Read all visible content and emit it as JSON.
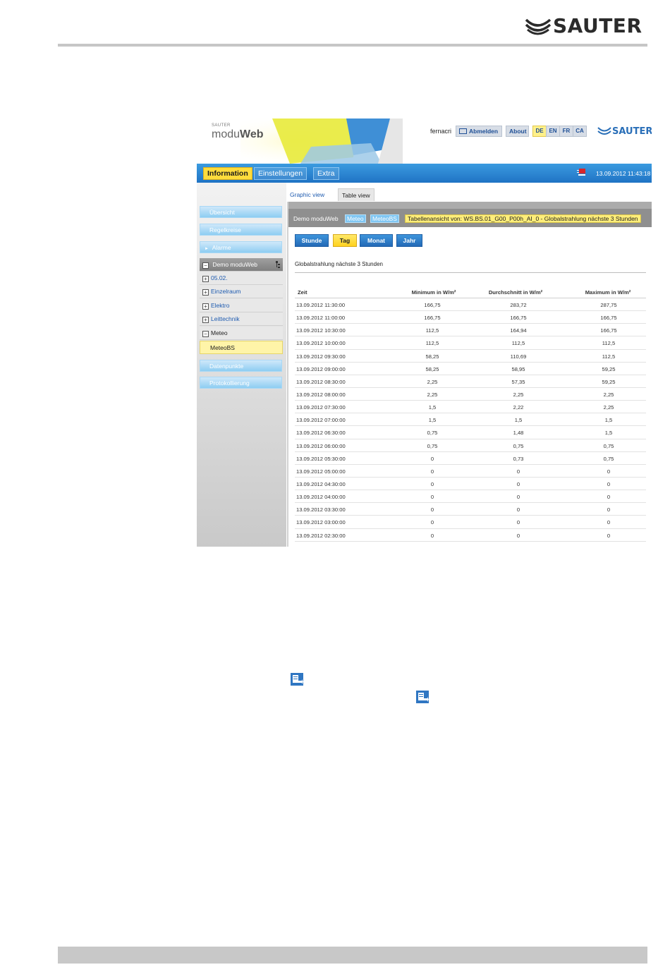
{
  "page": {
    "brand": "SAUTER"
  },
  "app": {
    "brand_small": "SAUTER",
    "brand_main_light": "modu",
    "brand_main_bold": "Web",
    "user": "fernacri",
    "logout_label": "Abmelden",
    "about_label": "About",
    "languages": [
      {
        "code": "DE",
        "active": true
      },
      {
        "code": "EN",
        "active": false
      },
      {
        "code": "FR",
        "active": false
      },
      {
        "code": "CA",
        "active": false
      }
    ],
    "logo_brand": "SAUTER",
    "nav": [
      {
        "label": "Information",
        "active": true
      },
      {
        "label": "Einstellungen",
        "active": false
      },
      {
        "label": "Extra",
        "active": false
      }
    ],
    "datetime": "13.09.2012 11:43:18"
  },
  "sidebar": {
    "items": [
      {
        "label": "Übersicht"
      },
      {
        "label": "Regelkreise"
      },
      {
        "label": "Alarme"
      }
    ],
    "tree_root": "Demo moduWeb",
    "tree_children": [
      {
        "label": "05.02.",
        "expander": "+"
      },
      {
        "label": "Einzelraum",
        "expander": "+"
      },
      {
        "label": "Elektro",
        "expander": "+"
      },
      {
        "label": "Leittechnik",
        "expander": "+"
      },
      {
        "label": "Meteo",
        "expander": "−"
      }
    ],
    "tree_selected": "MeteoBS",
    "bottom_items": [
      {
        "label": "Datenpunkte"
      },
      {
        "label": "Protokollierung"
      }
    ]
  },
  "view_tabs": [
    {
      "label": "Graphic view",
      "active": false
    },
    {
      "label": "Table view",
      "active": true
    }
  ],
  "breadcrumb": {
    "root": "Demo moduWeb",
    "level1": "Meteo",
    "level2": "MeteoBS",
    "current": "Tabellenansicht von: WS.BS.01_G00_P00h_AI_0 - Globalstrahlung nächste 3 Stunden"
  },
  "periods": [
    {
      "label": "Stunde",
      "active": false
    },
    {
      "label": "Tag",
      "active": true
    },
    {
      "label": "Monat",
      "active": false
    },
    {
      "label": "Jahr",
      "active": false
    }
  ],
  "table": {
    "title": "Globalstrahlung nächste 3 Stunden",
    "columns": [
      "Zeit",
      "Minimum in W/m²",
      "Durchschnitt in W/m²",
      "Maximum in W/m²"
    ],
    "rows": [
      [
        "13.09.2012 11:30:00",
        "166,75",
        "283,72",
        "287,75"
      ],
      [
        "13.09.2012 11:00:00",
        "166,75",
        "166,75",
        "166,75"
      ],
      [
        "13.09.2012 10:30:00",
        "112,5",
        "164,94",
        "166,75"
      ],
      [
        "13.09.2012 10:00:00",
        "112,5",
        "112,5",
        "112,5"
      ],
      [
        "13.09.2012 09:30:00",
        "58,25",
        "110,69",
        "112,5"
      ],
      [
        "13.09.2012 09:00:00",
        "58,25",
        "58,95",
        "59,25"
      ],
      [
        "13.09.2012 08:30:00",
        "2,25",
        "57,35",
        "59,25"
      ],
      [
        "13.09.2012 08:00:00",
        "2,25",
        "2,25",
        "2,25"
      ],
      [
        "13.09.2012 07:30:00",
        "1,5",
        "2,22",
        "2,25"
      ],
      [
        "13.09.2012 07:00:00",
        "1,5",
        "1,5",
        "1,5"
      ],
      [
        "13.09.2012 06:30:00",
        "0,75",
        "1,48",
        "1,5"
      ],
      [
        "13.09.2012 06:00:00",
        "0,75",
        "0,75",
        "0,75"
      ],
      [
        "13.09.2012 05:30:00",
        "0",
        "0,73",
        "0,75"
      ],
      [
        "13.09.2012 05:00:00",
        "0",
        "0",
        "0"
      ],
      [
        "13.09.2012 04:30:00",
        "0",
        "0",
        "0"
      ],
      [
        "13.09.2012 04:00:00",
        "0",
        "0",
        "0"
      ],
      [
        "13.09.2012 03:30:00",
        "0",
        "0",
        "0"
      ],
      [
        "13.09.2012 03:00:00",
        "0",
        "0",
        "0"
      ],
      [
        "13.09.2012 02:30:00",
        "0",
        "0",
        "0"
      ]
    ]
  },
  "colors": {
    "nav_blue": "#2b86d4",
    "active_yellow": "#ffdc3c",
    "sidebar_button": "#8ecdf2",
    "link_blue": "#1e5bb0"
  }
}
